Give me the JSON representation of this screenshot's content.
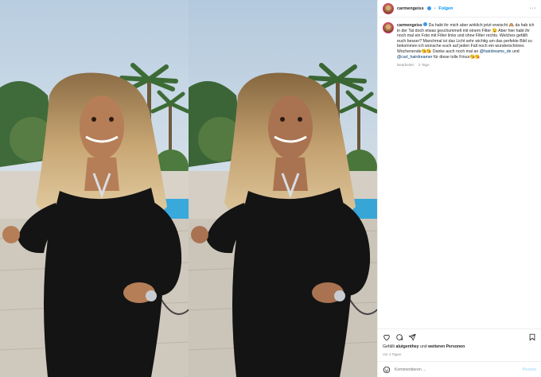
{
  "header": {
    "username": "carmengeiss",
    "separator": "•",
    "follow_label": "Folgen",
    "more_label": "···"
  },
  "caption": {
    "username": "carmengeiss",
    "text_part1": "Da habt ihr mich aber wirklich jetzt erwischt 🙈 da hab ich in der Tat doch etwas geschummelt mit einem Filter 😉 Aber hier habt ihr noch mal ein Foto mit Filter links und ohne Filter rechts. Welches gefällt euch besser? Manchmal ist das Licht sehr wichtig um das perfekte Bild zu bekommen ich wünsche euch auf jeden Fall noch ein wunderschönes Wochenende😘😘 Danke auch noch mal an ",
    "mention1": "@hairdreams_de",
    "text_part2": " und ",
    "mention2": "@carl_hairdreamer",
    "text_part3": " für diese tolle Frisur😘😘",
    "edited_label": "Bearbeitet",
    "age": "2 Tage"
  },
  "likes": {
    "prefix": "Gefällt ",
    "user": "alutgenthey",
    "middle": " und ",
    "others": "weiteren Personen"
  },
  "date_label": "Vor 4 Tagen",
  "comment_box": {
    "placeholder": "Kommentieren ...",
    "post_label": "Posten"
  },
  "icons": [
    "heart-icon",
    "comment-icon",
    "share-icon",
    "bookmark-icon",
    "emoji-icon",
    "more-icon",
    "verified-icon"
  ],
  "colors": {
    "accent": "#0095f6",
    "verified": "#3897f0",
    "text": "#262626",
    "muted": "#8e8e8e",
    "mention": "#00376b"
  }
}
